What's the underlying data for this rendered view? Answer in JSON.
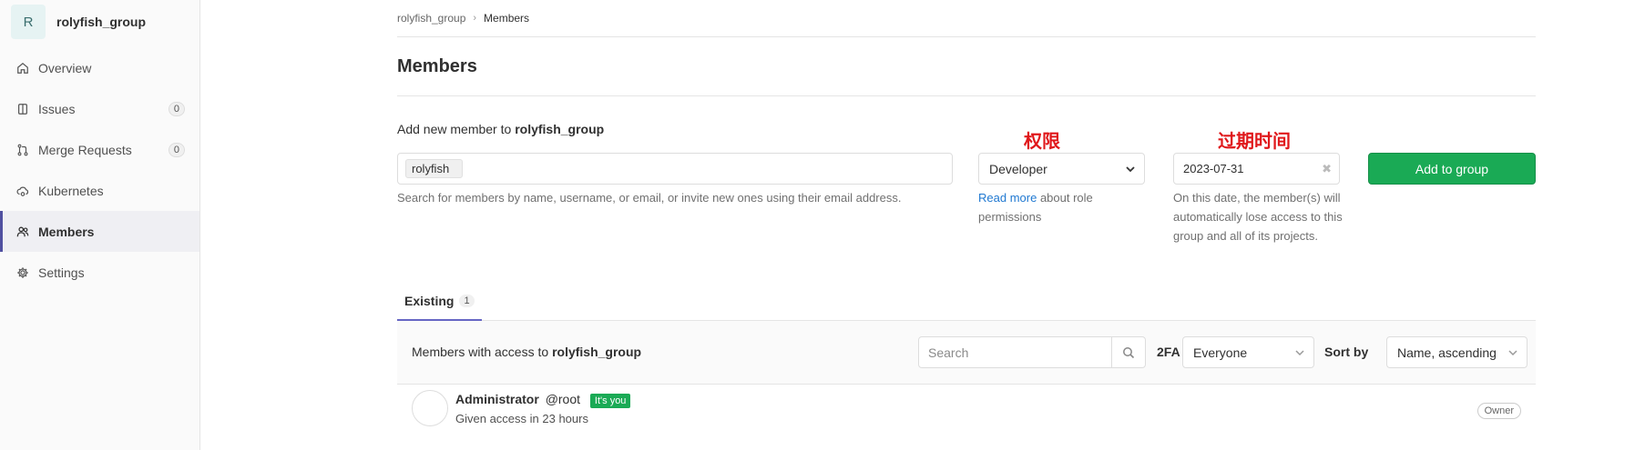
{
  "sidebar": {
    "group_initial": "R",
    "group_name": "rolyfish_group",
    "items": [
      {
        "label": "Overview",
        "icon": "home-icon"
      },
      {
        "label": "Issues",
        "icon": "issues-icon",
        "count": "0"
      },
      {
        "label": "Merge Requests",
        "icon": "merge-request-icon",
        "count": "0"
      },
      {
        "label": "Kubernetes",
        "icon": "cloud-gear-icon"
      },
      {
        "label": "Members",
        "icon": "users-icon",
        "active": true
      },
      {
        "label": "Settings",
        "icon": "gear-icon"
      }
    ]
  },
  "breadcrumb": {
    "group": "rolyfish_group",
    "current": "Members"
  },
  "page_title": "Members",
  "add_member": {
    "label_prefix": "Add new member to",
    "group": "rolyfish_group",
    "token": "rolyfish",
    "help": "Search for members by name, username, or email, or invite new ones using their email address.",
    "annotation_role": "权限",
    "annotation_expiry": "过期时间",
    "role_value": "Developer",
    "role_help_link": "Read more",
    "role_help_text": "about role permissions",
    "date_value": "2023-07-31",
    "date_help": "On this date, the member(s) will automatically lose access to this group and all of its projects.",
    "add_button": "Add to group"
  },
  "tabs": [
    {
      "label": "Existing",
      "count": "1"
    }
  ],
  "filter": {
    "text_prefix": "Members with access to",
    "group": "rolyfish_group",
    "search_placeholder": "Search",
    "twofa_label": "2FA",
    "twofa_value": "Everyone",
    "sort_label": "Sort by",
    "sort_value": "Name, ascending"
  },
  "members": [
    {
      "name": "Administrator",
      "handle": "@root",
      "badge": "It's you",
      "access": "Given access in 23 hours",
      "role": "Owner"
    }
  ],
  "colors": {
    "accent": "#1aaa55",
    "annotation": "#e0181b",
    "active_nav": "#5050a0"
  }
}
